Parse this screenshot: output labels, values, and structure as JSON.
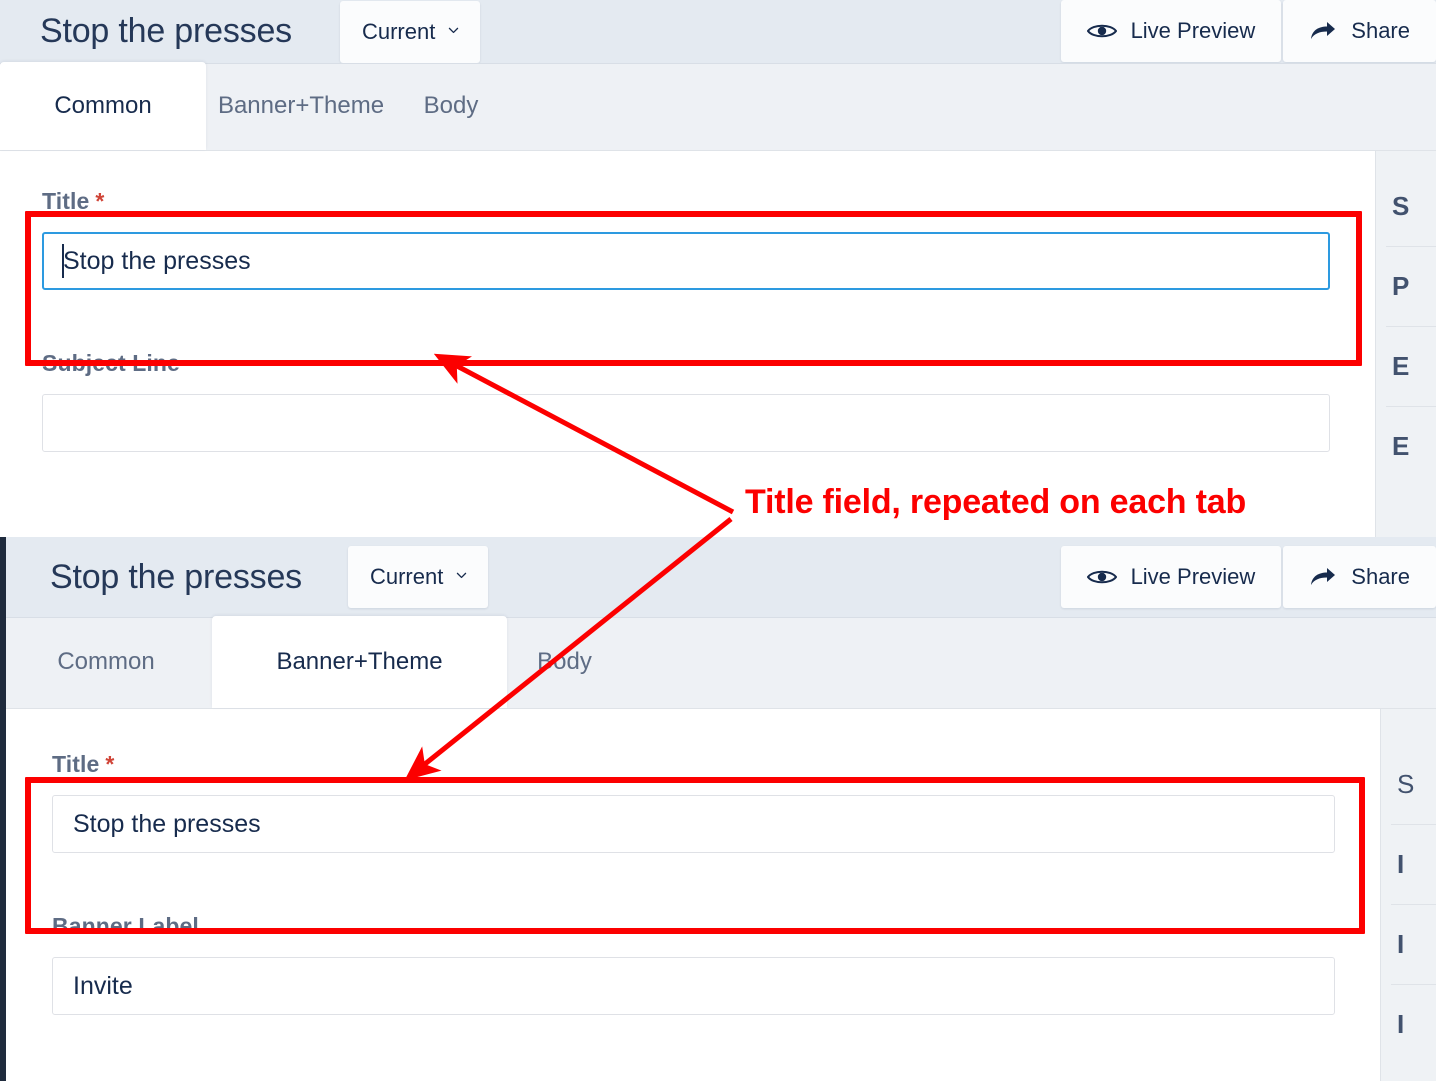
{
  "colors": {
    "annotation_red": "#fc0000",
    "header_bg": "#e4eaf1",
    "tabstrip_bg": "#eef1f5",
    "focus_blue": "#2d9ae0",
    "required_red": "#d04437",
    "label_gray": "#5e6c84",
    "text_dark": "#172b4d"
  },
  "annotation": {
    "callout_text": "Title field, repeated on each tab",
    "highlight_box_label": "title-field-highlight",
    "arrow_count": 2
  },
  "panel_top": {
    "header": {
      "title": "Stop the presses",
      "version_select": {
        "label": "Current",
        "icon": "chevron-down-icon"
      },
      "actions": [
        {
          "label": "Live Preview",
          "icon": "eye-icon"
        },
        {
          "label": "Share",
          "icon": "share-arrow-icon"
        }
      ]
    },
    "tabs": [
      {
        "label": "Common",
        "active": true
      },
      {
        "label": "Banner+Theme",
        "active": false
      },
      {
        "label": "Body",
        "active": false
      }
    ],
    "fields": [
      {
        "label": "Title",
        "required": true,
        "required_marker": "*",
        "value": "Stop the presses",
        "placeholder": "",
        "focused": true
      },
      {
        "label": "Subject Line",
        "required": false,
        "required_marker": "",
        "value": "",
        "placeholder": "",
        "focused": false
      }
    ],
    "side_items": [
      "S",
      "P",
      "E",
      "E"
    ]
  },
  "panel_bottom": {
    "header": {
      "title": "Stop the presses",
      "version_select": {
        "label": "Current",
        "icon": "chevron-down-icon"
      },
      "actions": [
        {
          "label": "Live Preview",
          "icon": "eye-icon"
        },
        {
          "label": "Share",
          "icon": "share-arrow-icon"
        }
      ]
    },
    "tabs": [
      {
        "label": "Common",
        "active": false
      },
      {
        "label": "Banner+Theme",
        "active": true
      },
      {
        "label": "Body",
        "active": false
      }
    ],
    "fields": [
      {
        "label": "Title",
        "required": true,
        "required_marker": "*",
        "value": "Stop the presses",
        "placeholder": "",
        "focused": false
      },
      {
        "label": "Banner Label",
        "required": false,
        "required_marker": "",
        "value": "Invite",
        "placeholder": "",
        "focused": false
      }
    ],
    "side_items": [
      "S",
      "I",
      "I",
      "I"
    ]
  }
}
